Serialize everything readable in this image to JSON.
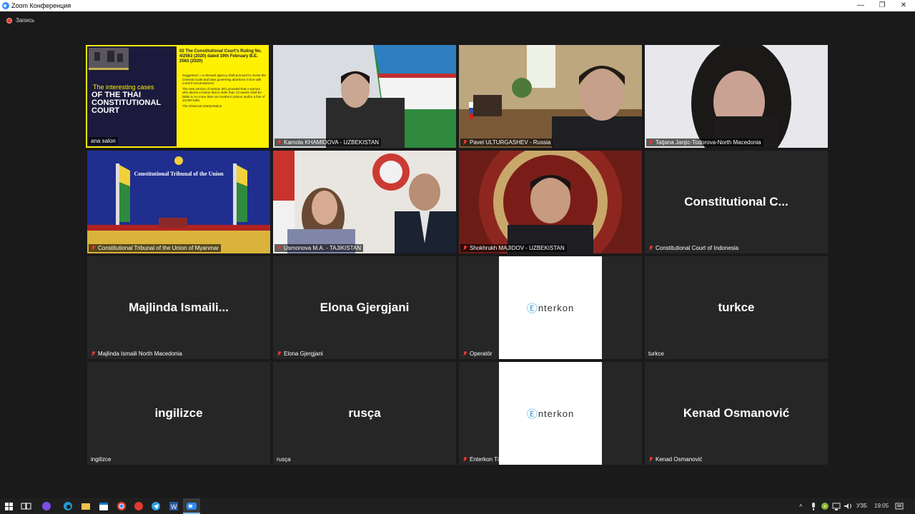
{
  "window": {
    "title": "Zoom Конференция",
    "minimize_glyph": "—",
    "restore_glyph": "❐",
    "close_glyph": "✕"
  },
  "recording": {
    "label": "Запись"
  },
  "slide": {
    "small_heading": "The interesting cases",
    "big_heading": "OF THE THAI CONSTITUTIONAL COURT",
    "section_title": "02  The Constitutional Court's Ruling No. 4/2563 (2020) dated 19th February B.E. 2563 (2020)",
    "bullets": [
      "Suggestion » a relevant agency shall proceed to revise the Criminal Code and laws governing abortions in line with current circumstances.",
      "The new version of section 301 provided that A woman who aborts a foetus that is older than 12 weeks shall be liable to no more than six months in prison and/or a fine of 10,000 baht.",
      "The Historical Interpretation"
    ]
  },
  "participants": [
    {
      "name": "ana salon",
      "muted": false,
      "kind": "slide"
    },
    {
      "name": "Kamola KHAMIDOVA - UZBEKISTAN",
      "muted": true,
      "kind": "video"
    },
    {
      "name": "Pavel ULTURGASHEV - Russia",
      "muted": true,
      "kind": "video"
    },
    {
      "name": "Tatjana Janjic-Todorova-North Macedonia",
      "muted": true,
      "kind": "video"
    },
    {
      "name": "Constitutional Tribunal of the Union of Myanmar",
      "muted": true,
      "kind": "video",
      "banner": "Constitutional Tribunal of the Union"
    },
    {
      "name": "Usmonova M.A. - TAJIKISTAN",
      "muted": true,
      "kind": "video"
    },
    {
      "name": "Shokhrukh MAJIDOV - UZBEKISTAN",
      "muted": true,
      "kind": "video"
    },
    {
      "name": "Constitutional Court of Indonesia",
      "muted": true,
      "kind": "name",
      "display": "Constitutional  C..."
    },
    {
      "name": "Majlinda Ismaili North Macedonia",
      "muted": true,
      "kind": "name",
      "display": "Majlinda  Ismaili..."
    },
    {
      "name": "Elona Gjergjani",
      "muted": true,
      "kind": "name",
      "display": "Elona Gjergjani"
    },
    {
      "name": "Operatör",
      "muted": true,
      "kind": "logo",
      "logo": "nterkon"
    },
    {
      "name": "turkce",
      "muted": false,
      "kind": "name",
      "display": "turkce"
    },
    {
      "name": "ingilizce",
      "muted": false,
      "kind": "name",
      "display": "ingilizce"
    },
    {
      "name": "rusça",
      "muted": false,
      "kind": "name",
      "display": "rusça"
    },
    {
      "name": "Enterkon Türkçe Kayıt",
      "muted": true,
      "kind": "logo",
      "logo": "nterkon"
    },
    {
      "name": "Kenad Osmanović",
      "muted": true,
      "kind": "name",
      "display": "Kenad Osmanović"
    }
  ],
  "taskbar": {
    "icons": [
      "windows-start-icon",
      "task-view-icon",
      "app-purple-icon",
      "edge-icon",
      "file-explorer-icon",
      "calendar-icon",
      "chrome-icon",
      "yandex-icon",
      "telegram-icon",
      "word-icon",
      "zoom-icon"
    ],
    "lang": "УЗБ",
    "time": "19:05"
  },
  "colors": {
    "accent": "#2d8cff",
    "slide_yellow": "#fff100",
    "slide_dark": "#1b1a3c"
  }
}
